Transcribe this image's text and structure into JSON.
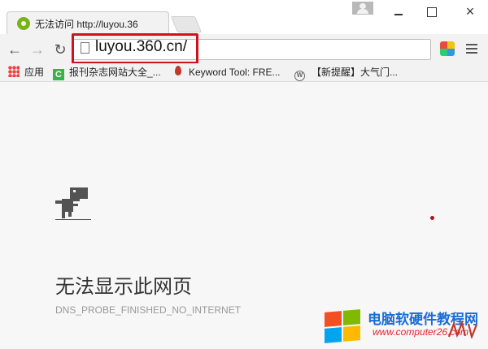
{
  "tab": {
    "title": "无法访问 http://luyou.36",
    "icon": "360-browser-icon"
  },
  "window_controls": {
    "user": "user-icon",
    "minimize": "minimize-icon",
    "maximize": "maximize-icon",
    "close": "×"
  },
  "toolbar": {
    "back": "←",
    "forward": "→",
    "reload": "↻",
    "url": "luyou.360.cn/"
  },
  "bookmarks": [
    {
      "label": "应用",
      "icon": "apps-grid-icon"
    },
    {
      "label": "报刊杂志网站大全_...",
      "icon": "c-site-icon"
    },
    {
      "label": "Keyword Tool: FRE...",
      "icon": "flame-icon"
    },
    {
      "label": "【新提醒】大气门...",
      "icon": "wordpress-icon"
    }
  ],
  "error": {
    "title": "无法显示此网页",
    "code": "DNS_PROBE_FINISHED_NO_INTERNET"
  },
  "watermark": {
    "name": "电脑软硬件教程网",
    "url": "www.computer26.com"
  },
  "colors": {
    "highlight": "#d0121c",
    "accent_blue": "#1a6cd6",
    "watermark_red": "#e3242b"
  }
}
